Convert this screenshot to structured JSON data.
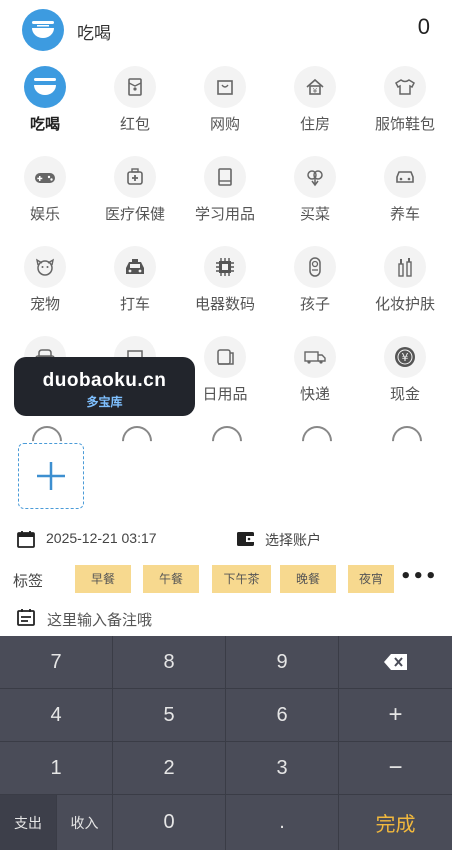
{
  "header": {
    "category": "吃喝",
    "amount": "0"
  },
  "categories": [
    {
      "label": "吃喝",
      "icon": "bowl-icon",
      "selected": true
    },
    {
      "label": "红包",
      "icon": "red-packet-icon"
    },
    {
      "label": "网购",
      "icon": "shopping-bag-icon"
    },
    {
      "label": "住房",
      "icon": "house-icon"
    },
    {
      "label": "服饰鞋包",
      "icon": "shirt-icon"
    },
    {
      "label": "娱乐",
      "icon": "gamepad-icon"
    },
    {
      "label": "医疗保健",
      "icon": "medical-kit-icon"
    },
    {
      "label": "学习用品",
      "icon": "book-icon"
    },
    {
      "label": "买菜",
      "icon": "vegetable-icon"
    },
    {
      "label": "养车",
      "icon": "car-icon"
    },
    {
      "label": "宠物",
      "icon": "dog-icon"
    },
    {
      "label": "打车",
      "icon": "taxi-icon"
    },
    {
      "label": "电器数码",
      "icon": "chip-icon"
    },
    {
      "label": "孩子",
      "icon": "baby-icon"
    },
    {
      "label": "化妆护肤",
      "icon": "cosmetics-icon"
    },
    {
      "label": "",
      "icon": "sofa-icon"
    },
    {
      "label": "",
      "icon": "furniture-icon"
    },
    {
      "label": "日用品",
      "icon": "paper-roll-icon"
    },
    {
      "label": "快递",
      "icon": "truck-icon"
    },
    {
      "label": "现金",
      "icon": "coin-icon"
    }
  ],
  "watermark": {
    "main": "duobaoku.cn",
    "sub": "多宝库"
  },
  "info": {
    "datetime": "2025-12-21 03:17",
    "account": "选择账户"
  },
  "tags": {
    "label": "标签",
    "items": [
      "早餐",
      "午餐",
      "下午茶",
      "晚餐",
      "夜宵"
    ],
    "more": "•••"
  },
  "note": {
    "placeholder": "这里输入备注哦"
  },
  "keypad": {
    "keys": [
      "7",
      "8",
      "9",
      "4",
      "5",
      "6",
      "+",
      "1",
      "2",
      "3",
      "−",
      "0",
      "."
    ],
    "expense": "支出",
    "income": "收入",
    "done": "完成"
  },
  "colors": {
    "accent": "#3d9be0",
    "tag": "#f7d98f",
    "keypad": "#4a4c58",
    "done": "#f1b83d"
  }
}
